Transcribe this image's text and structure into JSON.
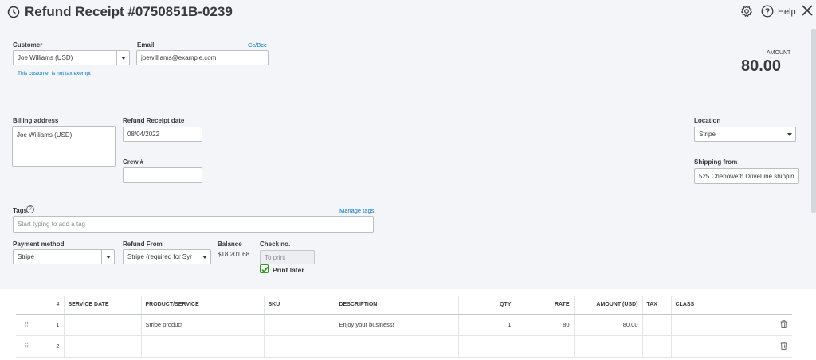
{
  "header": {
    "title": "Refund Receipt #0750851B-0239",
    "help_label": "Help",
    "icons": [
      "history-icon",
      "gear-icon",
      "help-icon",
      "close-icon"
    ]
  },
  "customer": {
    "label": "Customer",
    "value": "Joe Williams (USD)",
    "tax_note": "This customer is not tax exempt"
  },
  "email": {
    "label": "Email",
    "value": "joewilliams@example.com",
    "cc_bcc": "Cc/Bcc"
  },
  "amount": {
    "label": "AMOUNT",
    "value": "80.00"
  },
  "billing": {
    "label": "Billing address",
    "value": "Joe Williams (USD)"
  },
  "refund_date": {
    "label": "Refund Receipt date",
    "value": "08/04/2022"
  },
  "crew": {
    "label": "Crew #",
    "value": ""
  },
  "location": {
    "label": "Location",
    "value": "Stripe"
  },
  "shipping_from": {
    "label": "Shipping from",
    "value": "525 Chenoweth DriveLine shippin"
  },
  "tags": {
    "label": "Tags",
    "manage": "Manage tags",
    "placeholder": "Start typing to add a tag"
  },
  "payment": {
    "label": "Payment method",
    "value": "Stripe"
  },
  "refund_from": {
    "label": "Refund From",
    "value": "Stripe (required for Syr"
  },
  "balance": {
    "label": "Balance",
    "value": "$18,201.68"
  },
  "check": {
    "label": "Check no.",
    "placeholder": "To print",
    "print_later": "Print later",
    "print_later_checked": true
  },
  "table": {
    "columns": [
      "#",
      "SERVICE DATE",
      "PRODUCT/SERVICE",
      "SKU",
      "DESCRIPTION",
      "QTY",
      "RATE",
      "AMOUNT (USD)",
      "TAX",
      "CLASS"
    ],
    "rows": [
      {
        "n": "1",
        "service_date": "",
        "product": "Stripe product",
        "sku": "",
        "description": "Enjoy your business!",
        "qty": "1",
        "rate": "80",
        "amount": "80.00",
        "tax": "",
        "class": ""
      },
      {
        "n": "2",
        "service_date": "",
        "product": "",
        "sku": "",
        "description": "",
        "qty": "",
        "rate": "",
        "amount": "",
        "tax": "",
        "class": ""
      }
    ]
  },
  "colors": {
    "link": "#0077c5",
    "check_green": "#2ca01c",
    "background": "#f4f5f8"
  }
}
